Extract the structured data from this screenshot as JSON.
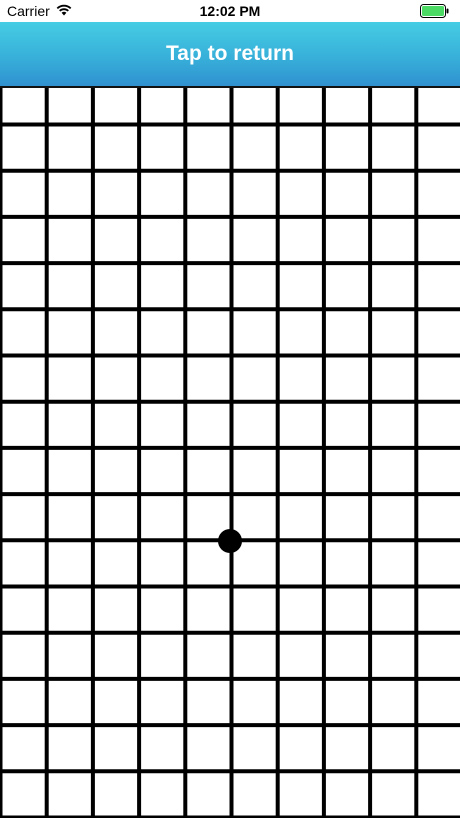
{
  "status_bar": {
    "carrier": "Carrier",
    "time": "12:02 PM",
    "wifi_icon": "wifi-icon",
    "battery_icon": "battery-icon",
    "battery_color": "#4cd964"
  },
  "header": {
    "title": "Tap to return",
    "gradient_top": "#46cde4",
    "gradient_bottom": "#2f8fcf"
  },
  "grid": {
    "columns": 10,
    "rows": 16,
    "line_color": "#000000",
    "cell_color": "#ffffff"
  },
  "marker": {
    "icon": "dot-icon",
    "color": "#000000"
  }
}
